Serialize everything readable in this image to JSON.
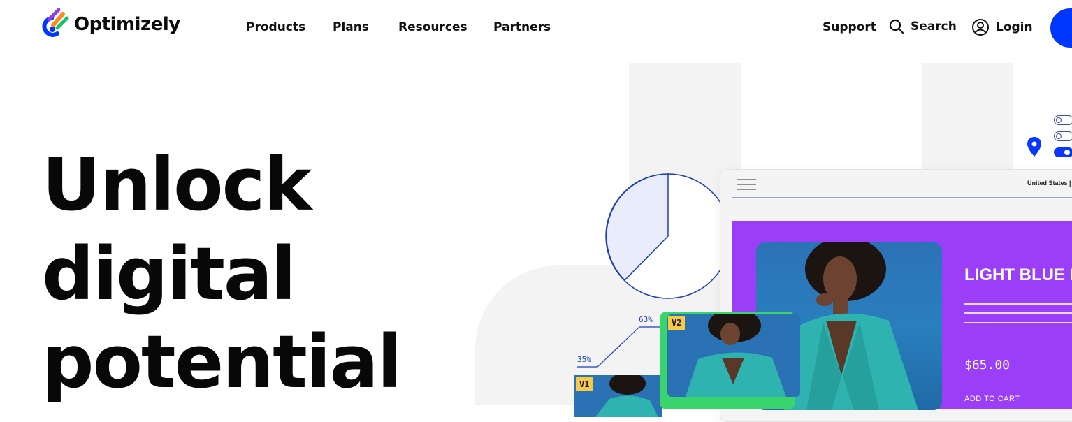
{
  "brand": {
    "name": "Optimizely",
    "accent": "#0037ff"
  },
  "nav": {
    "items": [
      {
        "label": "Products"
      },
      {
        "label": "Plans"
      },
      {
        "label": "Resources"
      },
      {
        "label": "Partners"
      }
    ]
  },
  "utility": {
    "support_label": "Support",
    "search_label": "Search",
    "login_label": "Login"
  },
  "hero": {
    "lines": [
      "Unlock",
      "digital",
      "potential"
    ]
  },
  "mockup": {
    "country_label": "United States |",
    "product_title": "LIGHT BLUE B",
    "price": "$65.00",
    "add_to_cart": "ADD TO CART",
    "variant_1": "V1",
    "variant_2": "V2",
    "stat_low": "35%",
    "stat_high": "63%",
    "purple_color": "#9b3ef7",
    "pie_chart": {
      "slices": [
        {
          "label": "highlighted",
          "fraction": 0.4
        },
        {
          "label": "rest",
          "fraction": 0.6
        }
      ]
    }
  }
}
